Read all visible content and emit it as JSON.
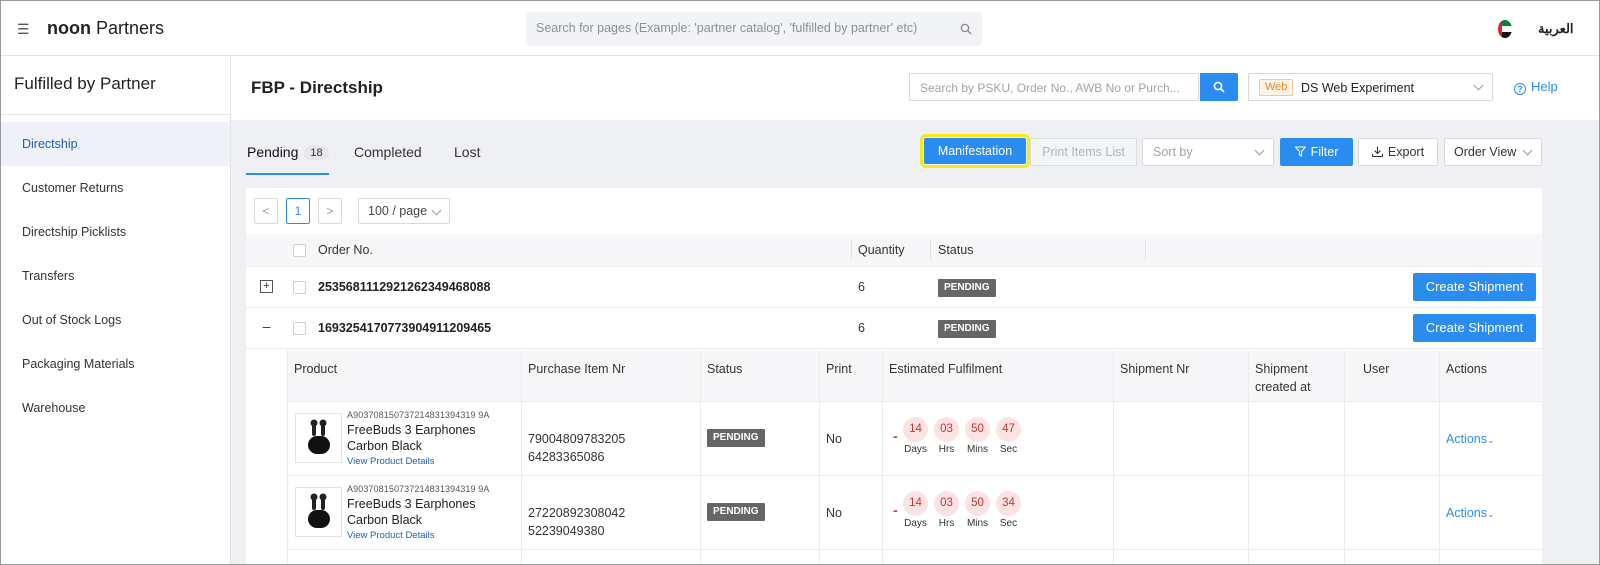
{
  "app": {
    "brand_bold": "noon",
    "brand_rest": " Partners",
    "global_search_placeholder": "Search for pages (Example: 'partner catalog', 'fulfilled by partner' etc)",
    "language": "العربية"
  },
  "sidebar": {
    "title": "Fulfilled by Partner",
    "items": [
      {
        "label": "Directship",
        "active": true
      },
      {
        "label": "Customer Returns"
      },
      {
        "label": "Directship Picklists"
      },
      {
        "label": "Transfers"
      },
      {
        "label": "Out of Stock Logs"
      },
      {
        "label": "Packaging Materials"
      },
      {
        "label": "Warehouse"
      }
    ]
  },
  "header": {
    "title": "FBP - Directship",
    "search_placeholder": "Search by PSKU, Order No., AWB No or Purch...",
    "experiment_badge": "Web",
    "experiment_label": "DS Web Experiment",
    "help": "Help"
  },
  "tabs": [
    {
      "label": "Pending",
      "count": "18",
      "active": true
    },
    {
      "label": "Completed"
    },
    {
      "label": "Lost"
    }
  ],
  "toolbar": {
    "manifestation": "Manifestation",
    "print_items": "Print Items List",
    "sort_placeholder": "Sort by",
    "filter": "Filter",
    "export": "Export",
    "order_view": "Order View"
  },
  "pagination": {
    "prev": "<",
    "current": "1",
    "next": ">",
    "per_page": "100 / page"
  },
  "table": {
    "columns": [
      "Order No.",
      "Quantity",
      "Status"
    ],
    "create_label": "Create Shipment",
    "orders": [
      {
        "order_no": "2535681112921262349468088",
        "quantity": "6",
        "status": "PENDING",
        "expanded": false
      },
      {
        "order_no": "169325417077390491120946​5",
        "quantity": "6",
        "status": "PENDING",
        "expanded": true
      }
    ]
  },
  "subtable": {
    "columns": [
      "Product",
      "Purchase Item Nr",
      "Status",
      "Print",
      "Estimated Fulfilment",
      "Shipment Nr",
      "Shipment created at",
      "User",
      "Actions"
    ],
    "timer_labels": [
      "Days",
      "Hrs",
      "Mins",
      "Sec"
    ],
    "view_details": "View Product Details",
    "actions_label": "Actions",
    "rows": [
      {
        "sku": "A903708150737214831394319 9A",
        "name": "FreeBuds 3 Earphones Carbon Black",
        "purchase_nrs": [
          "79004809783205",
          "64283365086"
        ],
        "status": "PENDING",
        "print": "No",
        "timer": [
          "14",
          "03",
          "50",
          "47"
        ]
      },
      {
        "sku": "A903708150737214831394319 9A",
        "name": "FreeBuds 3 Earphones Carbon Black",
        "purchase_nrs": [
          "27220892308042",
          "52239049380"
        ],
        "status": "PENDING",
        "print": "No",
        "timer": [
          "14",
          "03",
          "50",
          "34"
        ]
      }
    ]
  },
  "colors": {
    "primary": "#2b8cf0",
    "highlight": "#f2ea1a",
    "timer_bg": "#fbe3e3"
  }
}
